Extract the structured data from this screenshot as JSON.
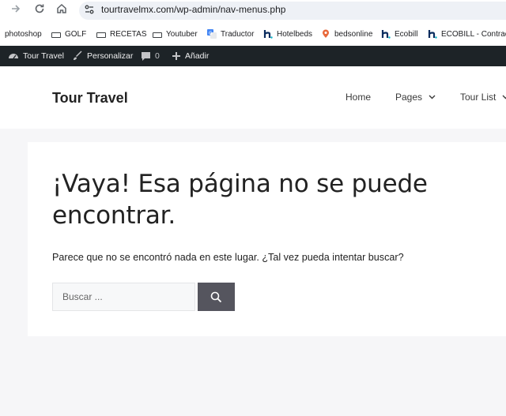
{
  "browser": {
    "url": "tourtravelmx.com/wp-admin/nav-menus.php",
    "bookmarks": [
      {
        "label": "photoshop",
        "icon": "none"
      },
      {
        "label": "GOLF",
        "icon": "folder-icon"
      },
      {
        "label": "RECETAS",
        "icon": "folder-icon"
      },
      {
        "label": "Youtuber",
        "icon": "folder-icon"
      },
      {
        "label": "Traductor",
        "icon": "translate-icon"
      },
      {
        "label": "Hotelbeds",
        "icon": "hotelbeds-icon"
      },
      {
        "label": "bedsonline",
        "icon": "bedsonline-icon"
      },
      {
        "label": "Ecobill",
        "icon": "hotelbeds-icon"
      },
      {
        "label": "ECOBILL - Contracting",
        "icon": "hotelbeds-icon"
      }
    ]
  },
  "adminbar": {
    "site_name": "Tour Travel",
    "customize": "Personalizar",
    "comments_count": "0",
    "add_new": "Añadir"
  },
  "header": {
    "site_title": "Tour Travel",
    "menu": [
      "Home",
      "Pages",
      "Tour List"
    ]
  },
  "content": {
    "title": "¡Vaya! Esa página no se puede encontrar.",
    "message": "Parece que no se encontró nada en este lugar. ¿Tal vez pueda intentar buscar?",
    "search_placeholder": "Buscar ..."
  },
  "colors": {
    "adminbar_bg": "#1d2327",
    "page_bg": "#f6f6f8",
    "search_button_bg": "#55555e"
  }
}
